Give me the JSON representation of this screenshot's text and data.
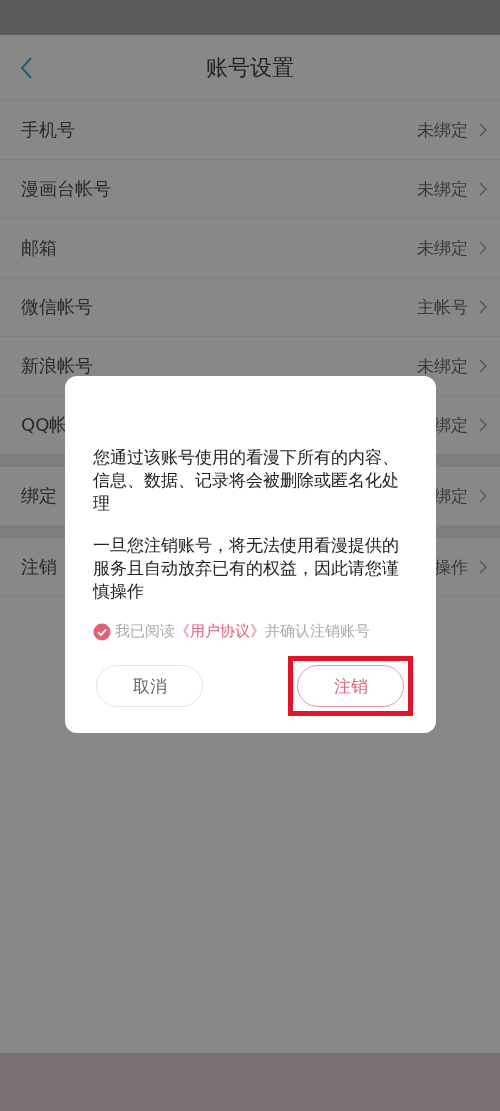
{
  "nav": {
    "title": "账号设置"
  },
  "groups": [
    {
      "rows": [
        {
          "label": "手机号",
          "value": "未绑定"
        },
        {
          "label": "漫画台帐号",
          "value": "未绑定"
        },
        {
          "label": "邮箱",
          "value": "未绑定"
        },
        {
          "label": "微信帐号",
          "value": "主帐号"
        },
        {
          "label": "新浪帐号",
          "value": "未绑定"
        },
        {
          "label": "QQ帐",
          "value": "绑定"
        }
      ]
    },
    {
      "rows": [
        {
          "label": "绑定",
          "value": "绑定"
        }
      ]
    },
    {
      "rows": [
        {
          "label": "注销",
          "value": "操作"
        }
      ]
    }
  ],
  "dialog": {
    "paragraphs": [
      "您通过该账号使用的看漫下所有的内容、信息、数据、记录将会被删除或匿名化处理",
      "一旦您注销账号，将无法使用看漫提供的服务且自动放弃已有的权益，因此请您谨慎操作"
    ],
    "agreement": {
      "checked": true,
      "prefix": "我已阅读",
      "link": "《用户协议》",
      "suffix": "并确认注销账号"
    },
    "buttons": [
      {
        "label": "取消",
        "kind": "secondary",
        "highlighted": false
      },
      {
        "label": "注销",
        "kind": "primary",
        "highlighted": true
      }
    ]
  }
}
